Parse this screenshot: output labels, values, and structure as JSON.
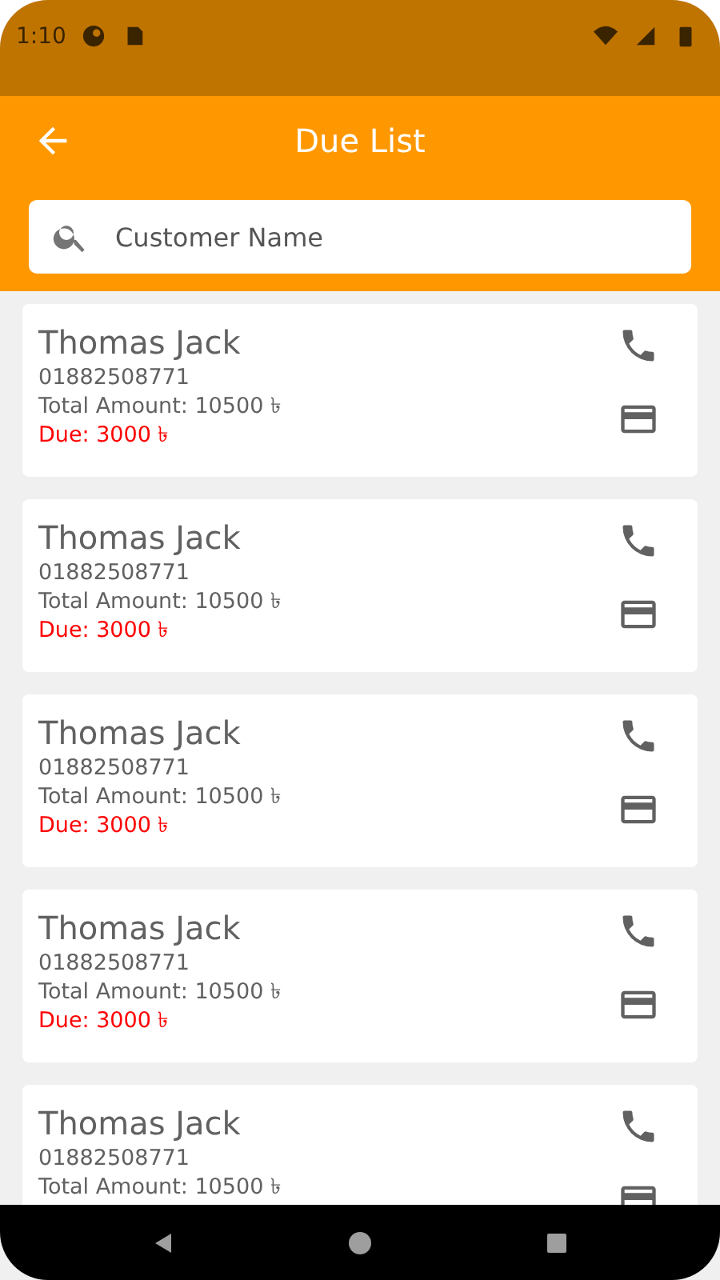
{
  "status_bar": {
    "time": "1:10"
  },
  "app_bar": {
    "title": "Due List"
  },
  "search": {
    "placeholder": "Customer Name"
  },
  "customers": [
    {
      "name": "Thomas Jack",
      "phone": "01882508771",
      "total": "Total Amount: 10500 ৳",
      "due": "Due: 3000 ৳"
    },
    {
      "name": "Thomas Jack",
      "phone": "01882508771",
      "total": "Total Amount: 10500 ৳",
      "due": "Due: 3000 ৳"
    },
    {
      "name": "Thomas Jack",
      "phone": "01882508771",
      "total": "Total Amount: 10500 ৳",
      "due": "Due: 3000 ৳"
    },
    {
      "name": "Thomas Jack",
      "phone": "01882508771",
      "total": "Total Amount: 10500 ৳",
      "due": "Due: 3000 ৳"
    },
    {
      "name": "Thomas Jack",
      "phone": "01882508771",
      "total": "Total Amount: 10500 ৳"
    }
  ]
}
